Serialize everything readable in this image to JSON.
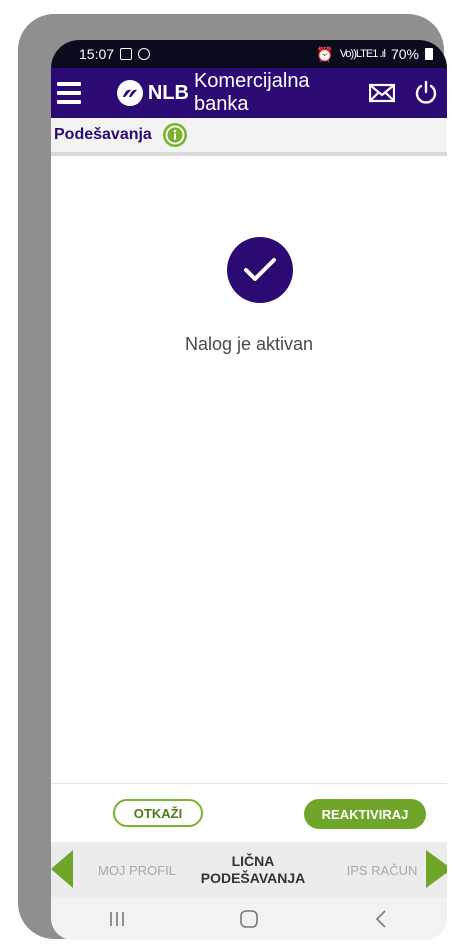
{
  "status_bar": {
    "time": "15:07",
    "signal": "Vo))LTE1 .ıl",
    "battery": "70%"
  },
  "header": {
    "brand": "NLB",
    "bank_name": "Komercijalna banka"
  },
  "breadcrumb": {
    "title": "Podešavanja"
  },
  "status_message": "Nalog je aktivan",
  "buttons": {
    "cancel": "OTKAŽI",
    "reactivate": "REAKTIVIRAJ"
  },
  "tabs": [
    {
      "label": "MOJ PROFIL"
    },
    {
      "label": "LIČNA PODEŠAVANJA"
    },
    {
      "label": "IPS RAČUN"
    }
  ],
  "colors": {
    "primary": "#2c0a73",
    "accent": "#6fa62a",
    "status_bar": "#0b0b1e"
  },
  "icons": [
    "menu-icon",
    "nlb-logo-icon",
    "mail-icon",
    "power-icon",
    "info-icon",
    "check-icon",
    "chevron-left-icon",
    "chevron-right-icon",
    "recent-apps-icon",
    "home-icon",
    "back-icon"
  ]
}
